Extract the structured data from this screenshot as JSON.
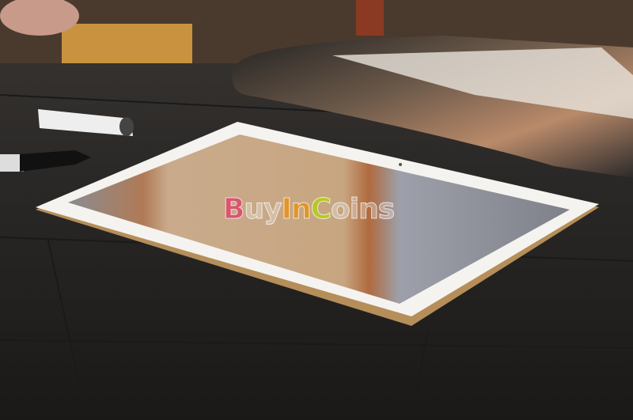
{
  "watermark": {
    "parts": [
      "B",
      "uy",
      "In",
      "C",
      "oins"
    ],
    "text": "BuyInCoins"
  },
  "colors": {
    "tablet_frame": "#f4f2ee",
    "tablet_rim": "#c9a46a",
    "screen": "#9f9ea3",
    "table": "#2a2826"
  }
}
